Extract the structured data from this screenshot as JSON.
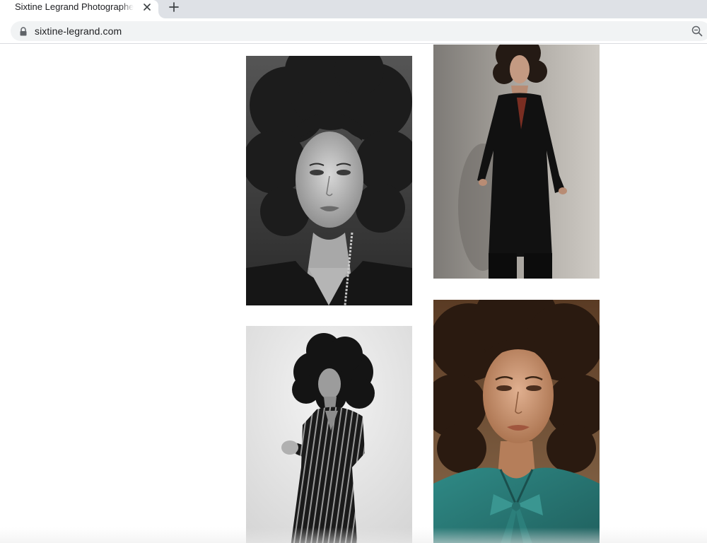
{
  "browser": {
    "tab_title": "Sixtine Legrand Photographe | ",
    "close_icon": "close-icon",
    "new_tab_icon": "plus-icon",
    "url": "sixtine-legrand.com",
    "lock_icon": "lock-icon",
    "zoom_icon": "zoom-icon"
  },
  "gallery": {
    "photos": [
      {
        "subject": "black-and-white close-up portrait, woman with voluminous curly hair"
      },
      {
        "subject": "full-length color portrait, woman in long black coat"
      },
      {
        "subject": "black-and-white portrait, woman in striped dress"
      },
      {
        "subject": "color close-up portrait, woman in teal blouse with bow"
      }
    ]
  },
  "colors": {
    "tabstrip": "#dee1e6",
    "omnibox": "#f1f3f4",
    "teal_blouse": "#2a7a78",
    "coat_lining": "#8a3a2a"
  }
}
